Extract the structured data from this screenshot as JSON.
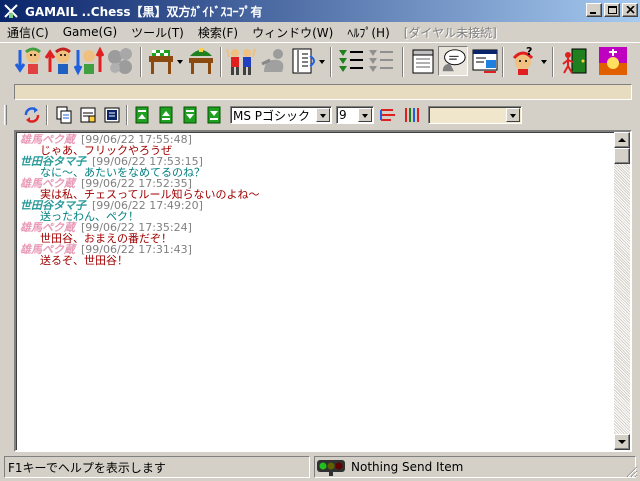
{
  "window": {
    "title": "GAMAIL ..Chess【黒】双方ｶﾞｲﾄﾞｽｺｰﾌﾟ有"
  },
  "menu": [
    {
      "label": "通信(C)",
      "enabled": true
    },
    {
      "label": "Game(G)",
      "enabled": true
    },
    {
      "label": "ツール(T)",
      "enabled": true
    },
    {
      "label": "検索(F)",
      "enabled": true
    },
    {
      "label": "ウィンドウ(W)",
      "enabled": true
    },
    {
      "label": "ﾍﾙﾌﾟ(H)",
      "enabled": true
    },
    {
      "label": "[ダイヤル未接続]",
      "enabled": false
    }
  ],
  "format": {
    "font": "MS Pゴシック",
    "size": "9",
    "color_value": ""
  },
  "colors": {
    "name_pink": "#e89cb8",
    "name_teal": "#2a9a9a",
    "text_red": "#a00000",
    "text_teal": "#008080",
    "time_gray": "#808080"
  },
  "messages": [
    {
      "name": "雄馬ペク蔵",
      "time": "[99/06/22 17:55:48]",
      "text": "じゃあ、フリックやろうぜ",
      "side": "pink"
    },
    {
      "name": "世田谷タマ子",
      "time": "[99/06/22 17:53:15]",
      "text": "なに～、あたいをなめてるのね？",
      "side": "teal"
    },
    {
      "name": "雄馬ペク蔵",
      "time": "[99/06/22 17:52:35]",
      "text": "実は私、チェスってルール知らないのよね～",
      "side": "pink"
    },
    {
      "name": "世田谷タマ子",
      "time": "[99/06/22 17:49:20]",
      "text": "送ったわん、ペク！",
      "side": "teal"
    },
    {
      "name": "雄馬ペク蔵",
      "time": "[99/06/22 17:35:24]",
      "text": "世田谷、おまえの番だぞ！",
      "side": "pink"
    },
    {
      "name": "雄馬ペク蔵",
      "time": "[99/06/22 17:31:43]",
      "text": "送るぞ、世田谷！",
      "side": "pink"
    }
  ],
  "status": {
    "help_text": "F1キーでヘルプを表示します",
    "send_status": "Nothing Send Item"
  }
}
